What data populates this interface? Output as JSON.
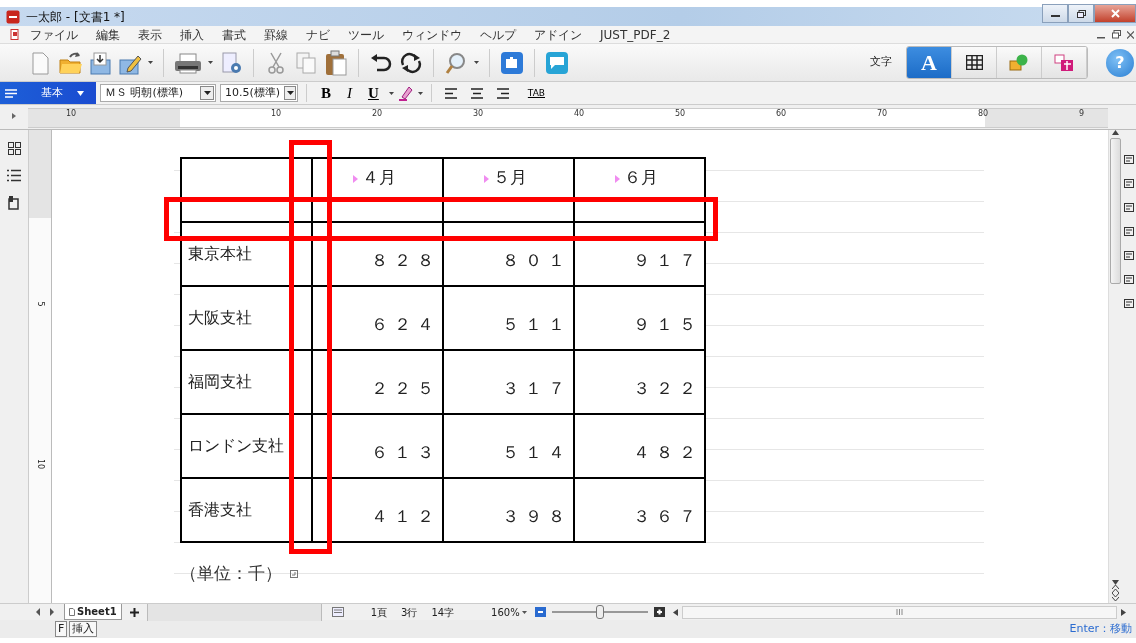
{
  "window": {
    "title": "一太郎 - [文書1 *]"
  },
  "menu": [
    "ファイル",
    "編集",
    "表示",
    "挿入",
    "書式",
    "罫線",
    "ナビ",
    "ツール",
    "ウィンドウ",
    "ヘルプ",
    "アドイン",
    "JUST_PDF_2"
  ],
  "toolbar_right": {
    "label": "文字",
    "modes": [
      {
        "kind": "text",
        "label": "A",
        "selected": true
      },
      {
        "kind": "table",
        "selected": false
      },
      {
        "kind": "shape",
        "selected": false
      },
      {
        "kind": "stamp",
        "selected": false
      }
    ],
    "help": "?"
  },
  "format_bar": {
    "style": "基本",
    "font": "ＭＳ 明朝(標準)",
    "size": "10.5(標準)",
    "bold": "B",
    "italic": "I",
    "underline": "U",
    "tab": "TAB"
  },
  "ruler": {
    "labels": [
      "10",
      "10",
      "20",
      "30",
      "40",
      "50",
      "60",
      "70",
      "80",
      "9"
    ],
    "vertical_labels": [
      "5",
      "10"
    ]
  },
  "table": {
    "header": [
      "４月",
      "５月",
      "６月"
    ],
    "rows": [
      {
        "label": "東京本社",
        "values": [
          "８２８",
          "８０１",
          "９１７"
        ]
      },
      {
        "label": "大阪支社",
        "values": [
          "６２４",
          "５１１",
          "９１５"
        ]
      },
      {
        "label": "福岡支社",
        "values": [
          "２２５",
          "３１７",
          "３２２"
        ]
      },
      {
        "label": "ロンドン支社",
        "values": [
          "６１３",
          "５１４",
          "４８２"
        ]
      },
      {
        "label": "香港支社",
        "values": [
          "４１２",
          "３９８",
          "３６７"
        ]
      }
    ]
  },
  "note": "（単位：千）",
  "highlights": {
    "column_border": true,
    "header_border": true
  },
  "sheet_tabs": [
    {
      "label": "Sheet1",
      "selected": true
    }
  ],
  "status": {
    "page": "1頁",
    "line": "3行",
    "chars": "14字",
    "zoom": "160%",
    "zoom_slider": {
      "level": 0.5
    }
  },
  "status_bar": {
    "mode_key": "F",
    "mode": "挿入",
    "hint": "Enter：移動"
  }
}
